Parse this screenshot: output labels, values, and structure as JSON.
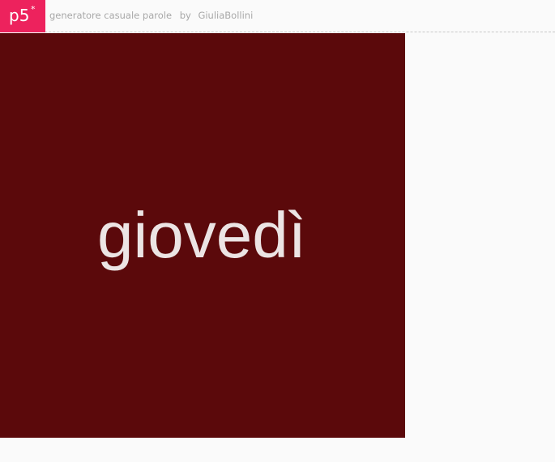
{
  "header": {
    "logo_text": "p5",
    "logo_star": "*",
    "sketch_title": "generatore casuale parole",
    "by_word": "by",
    "author": "GiuliaBollini"
  },
  "canvas": {
    "word": "giovedì"
  },
  "colors": {
    "brand": "#ed225d",
    "canvas_background": "#5b090b",
    "word_color": "#ece4e4",
    "header_text": "#a8a8a8",
    "page_background": "#fafafa"
  }
}
